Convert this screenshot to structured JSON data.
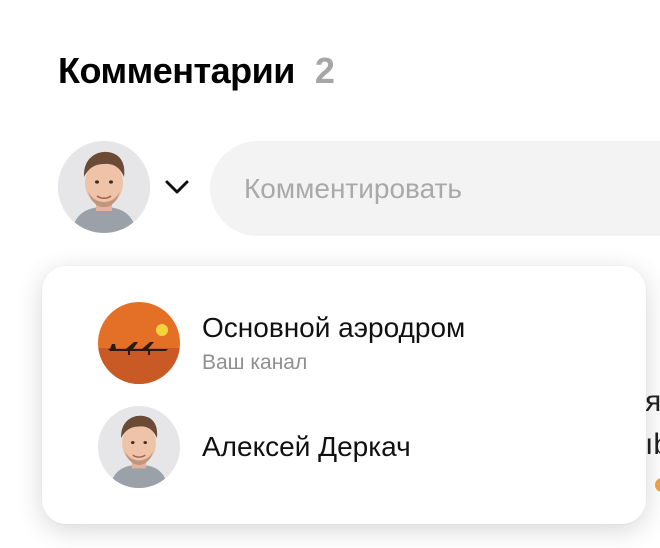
{
  "comments": {
    "title": "Комментарии",
    "count": "2",
    "input_placeholder": "Комментировать"
  },
  "account_menu": {
    "options": [
      {
        "name": "Основной аэродром",
        "subtitle": "Ваш канал",
        "icon": "airplane-sunset-avatar"
      },
      {
        "name": "Алексей Деркач",
        "icon": "user-photo-avatar"
      }
    ]
  },
  "background_peek": {
    "line1": "я",
    "line2": "ıb"
  },
  "colors": {
    "count_gray": "#a6a6a6",
    "input_bg": "#f3f3f3",
    "channel_orange": "#e46f27"
  }
}
